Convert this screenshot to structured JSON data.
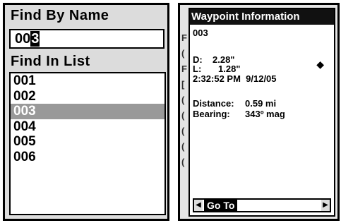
{
  "left_screen": {
    "find_by_name_title": "Find By Name",
    "name_entry": "00",
    "name_cursor": "3",
    "find_in_list_title": "Find In List",
    "items": [
      "001",
      "002",
      "003",
      "004",
      "005",
      "006"
    ],
    "selected": "003"
  },
  "right_screen": {
    "title": "Waypoint Information",
    "name": "003",
    "d_label": "D:",
    "d_value": "2.28\"",
    "l_label": "L:",
    "l_value": "1.28\"",
    "datetime": "2:32:52 PM  9/12/05",
    "distance_label": "Distance:",
    "distance_value": "0.59 mi",
    "bearing_label": "Bearing:",
    "bearing_value": "343º mag",
    "goto_label": "Go To",
    "compass_icon": "◆",
    "bg_letters": [
      "F",
      "(",
      "F",
      "[",
      "(",
      "(",
      "(",
      "(",
      "("
    ]
  }
}
